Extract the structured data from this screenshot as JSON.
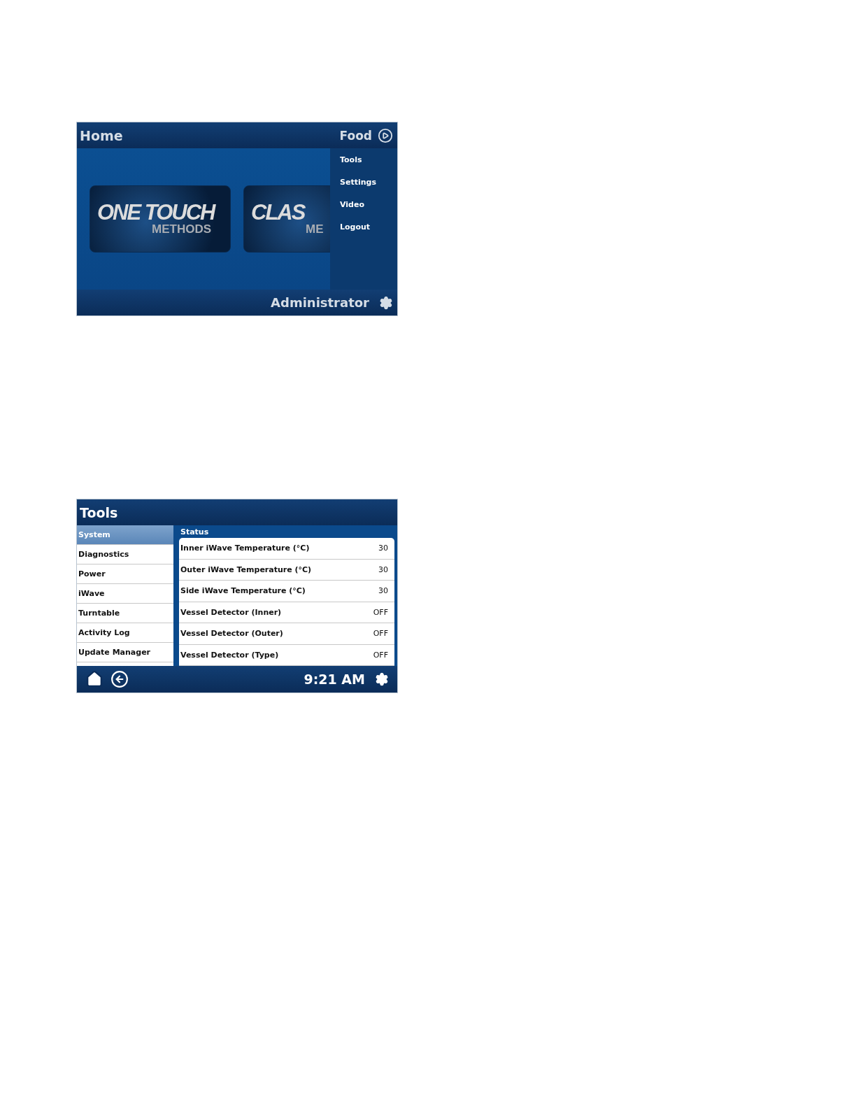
{
  "home_screen": {
    "title": "Home",
    "mode": {
      "label": "Food"
    },
    "tiles": [
      {
        "line_1": "ONE TOUCH",
        "line_2": "METHODS"
      },
      {
        "line_1": "CLAS",
        "line_2": "ME"
      }
    ],
    "menu": [
      {
        "label": "Tools"
      },
      {
        "label": "Settings"
      },
      {
        "label": "Video"
      },
      {
        "label": "Logout"
      }
    ],
    "user": "Administrator"
  },
  "tools_screen": {
    "title": "Tools",
    "sidebar": [
      {
        "label": "System",
        "selected": true
      },
      {
        "label": "Diagnostics",
        "selected": false
      },
      {
        "label": "Power",
        "selected": false
      },
      {
        "label": "iWave",
        "selected": false
      },
      {
        "label": "Turntable",
        "selected": false
      },
      {
        "label": "Activity Log",
        "selected": false
      },
      {
        "label": "Update Manager",
        "selected": false
      }
    ],
    "section_title": "Status",
    "rows": [
      {
        "label": "Inner iWave Temperature (°C)",
        "value": "30"
      },
      {
        "label": "Outer iWave Temperature (°C)",
        "value": "30"
      },
      {
        "label": "Side iWave Temperature (°C)",
        "value": "30"
      },
      {
        "label": "Vessel Detector (Inner)",
        "value": "OFF"
      },
      {
        "label": "Vessel Detector (Outer)",
        "value": "OFF"
      },
      {
        "label": "Vessel Detector (Type)",
        "value": "OFF"
      }
    ],
    "time": "9:21 AM"
  }
}
